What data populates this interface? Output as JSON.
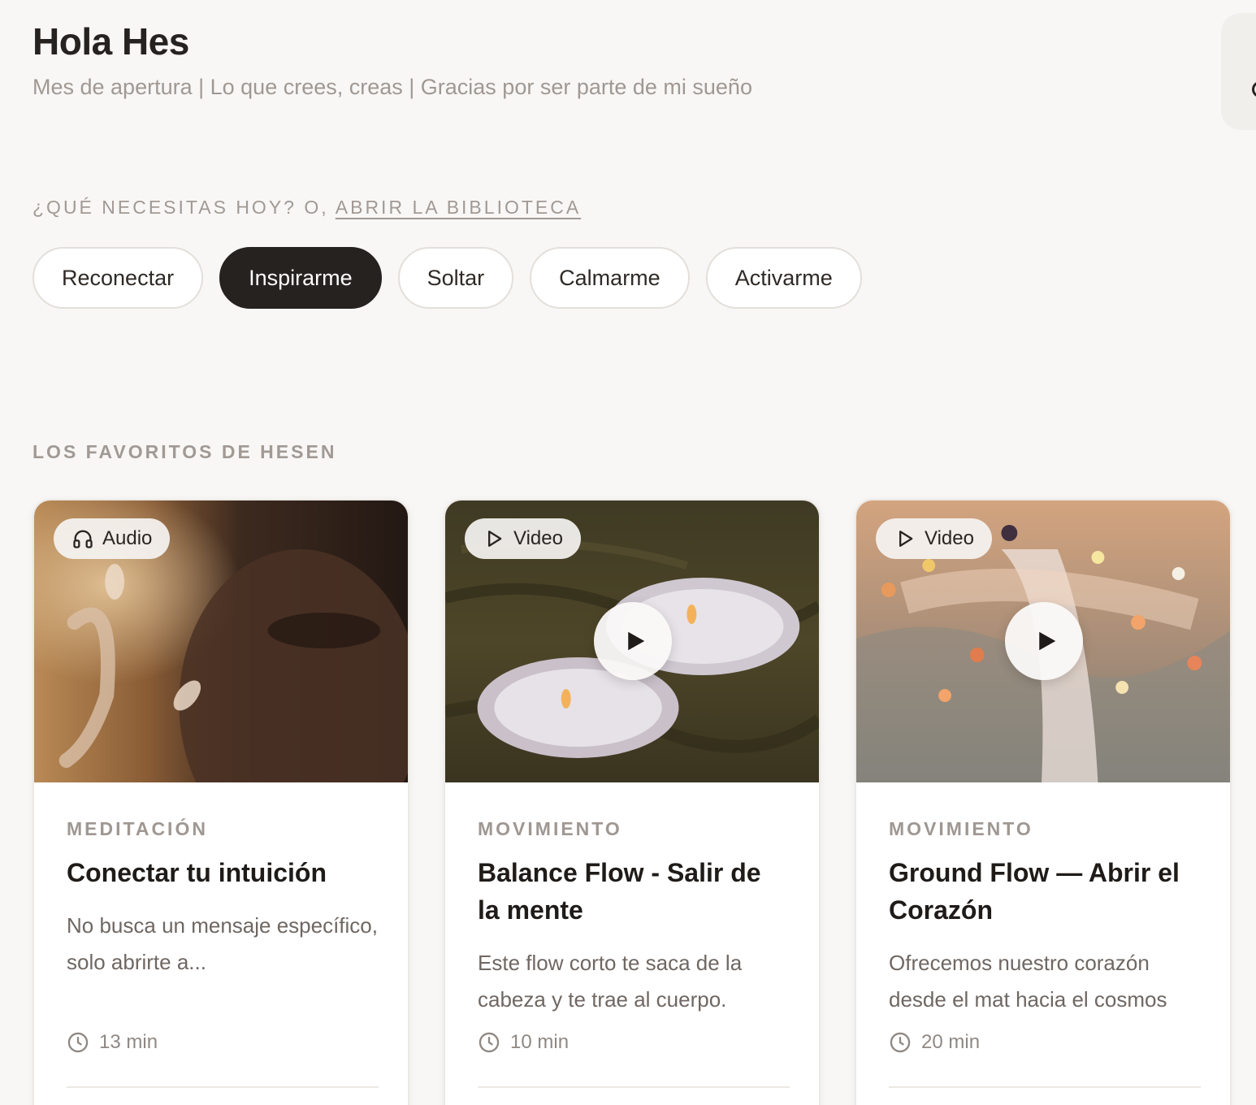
{
  "header": {
    "greeting": "Hola Hes",
    "subtitle": "Mes de apertura | Lo que crees, creas | Gracias por ser parte de mi sueño"
  },
  "prompt": {
    "question": "¿QUÉ NECESITAS HOY? O,",
    "library_link": "ABRIR LA BIBLIOTECA"
  },
  "moods": [
    {
      "label": "Reconectar",
      "active": false
    },
    {
      "label": "Inspirarme",
      "active": true
    },
    {
      "label": "Soltar",
      "active": false
    },
    {
      "label": "Calmarme",
      "active": false
    },
    {
      "label": "Activarme",
      "active": false
    }
  ],
  "favorites": {
    "section_title": "LOS FAVORITOS DE HESEN",
    "cards": [
      {
        "media_type": "Audio",
        "media_icon": "headphones-icon",
        "category": "MEDITACIÓN",
        "title": "Conectar tu intuición",
        "description": "No busca un mensaje específico, solo abrirte a...",
        "duration": "13 min"
      },
      {
        "media_type": "Video",
        "media_icon": "play-outline-icon",
        "category": "MOVIMIENTO",
        "title": "Balance Flow - Salir de la mente",
        "description": "Este flow corto te saca de la cabeza y te trae al cuerpo.",
        "duration": "10 min"
      },
      {
        "media_type": "Video",
        "media_icon": "play-outline-icon",
        "category": "MOVIMIENTO",
        "title": "Ground Flow — Abrir el Corazón",
        "description": "Ofrecemos nuestro corazón desde el mat hacia el cosmos",
        "duration": "20 min"
      }
    ]
  }
}
